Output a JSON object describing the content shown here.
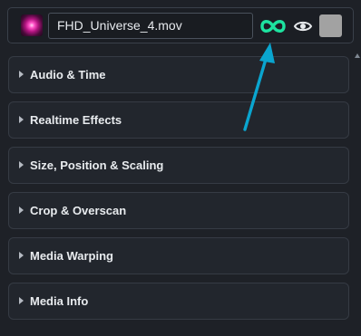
{
  "header": {
    "clip_name": "FHD_Universe_4.mov",
    "thumbnail_icon": "clip-thumbnail",
    "loop_icon": "infinity-loop-icon",
    "visibility_icon": "eye-icon",
    "swatch_icon": "color-swatch",
    "loop_color": "#1de3a0",
    "swatch_color": "#a2a2a2"
  },
  "annotation": {
    "arrow_icon": "annotation-arrow",
    "arrow_color": "#0aa5cf"
  },
  "sections": [
    {
      "label": "Audio & Time",
      "expanded": false
    },
    {
      "label": "Realtime Effects",
      "expanded": false
    },
    {
      "label": "Size, Position & Scaling",
      "expanded": false
    },
    {
      "label": "Crop & Overscan",
      "expanded": false
    },
    {
      "label": "Media Warping",
      "expanded": false
    },
    {
      "label": "Media Info",
      "expanded": false
    }
  ],
  "theme": {
    "background": "#1e2127",
    "panel": "#22262d",
    "border": "#363b44",
    "text": "#e8ebee"
  }
}
